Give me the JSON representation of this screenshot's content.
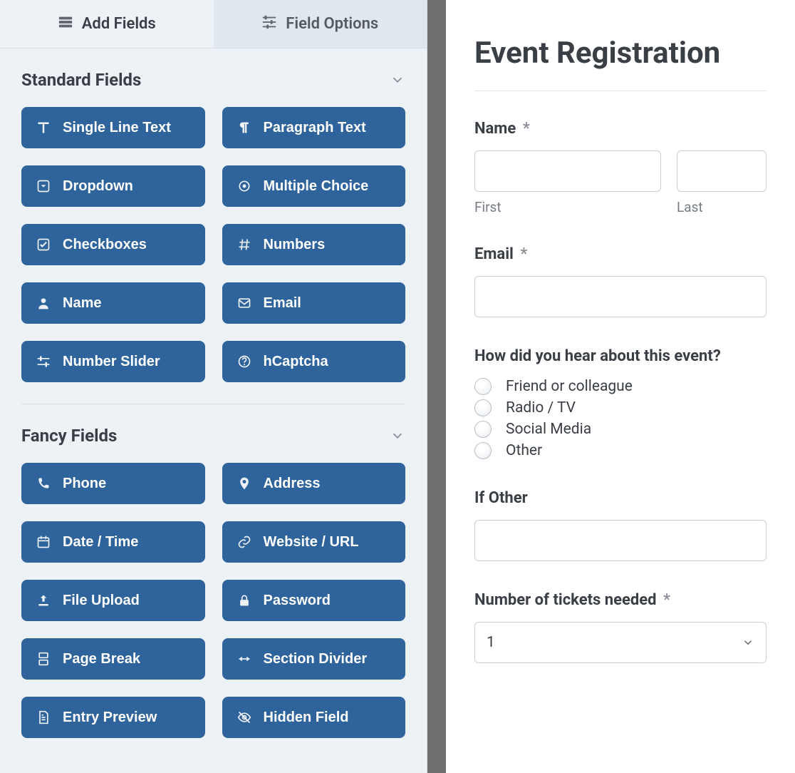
{
  "tabs": {
    "add_fields": "Add Fields",
    "field_options": "Field Options"
  },
  "sections": {
    "standard": {
      "title": "Standard Fields",
      "fields": [
        {
          "label": "Single Line Text",
          "icon": "text"
        },
        {
          "label": "Paragraph Text",
          "icon": "paragraph"
        },
        {
          "label": "Dropdown",
          "icon": "dropdown"
        },
        {
          "label": "Multiple Choice",
          "icon": "radio"
        },
        {
          "label": "Checkboxes",
          "icon": "check"
        },
        {
          "label": "Numbers",
          "icon": "hash"
        },
        {
          "label": "Name",
          "icon": "user"
        },
        {
          "label": "Email",
          "icon": "envelope"
        },
        {
          "label": "Number Slider",
          "icon": "slider"
        },
        {
          "label": "hCaptcha",
          "icon": "question"
        }
      ]
    },
    "fancy": {
      "title": "Fancy Fields",
      "fields": [
        {
          "label": "Phone",
          "icon": "phone"
        },
        {
          "label": "Address",
          "icon": "pin"
        },
        {
          "label": "Date / Time",
          "icon": "calendar"
        },
        {
          "label": "Website / URL",
          "icon": "link"
        },
        {
          "label": "File Upload",
          "icon": "upload"
        },
        {
          "label": "Password",
          "icon": "lock"
        },
        {
          "label": "Page Break",
          "icon": "pagebreak"
        },
        {
          "label": "Section Divider",
          "icon": "divider"
        },
        {
          "label": "Entry Preview",
          "icon": "doc"
        },
        {
          "label": "Hidden Field",
          "icon": "eyeoff"
        }
      ]
    }
  },
  "form": {
    "title": "Event Registration",
    "name": {
      "label": "Name",
      "required": "*",
      "first": "First",
      "last": "Last"
    },
    "email": {
      "label": "Email",
      "required": "*"
    },
    "hear": {
      "label": "How did you hear about this event?",
      "options": [
        "Friend or colleague",
        "Radio / TV",
        "Social Media",
        "Other"
      ]
    },
    "if_other": {
      "label": "If Other"
    },
    "tickets": {
      "label": "Number of tickets needed",
      "required": "*",
      "value": "1"
    }
  }
}
